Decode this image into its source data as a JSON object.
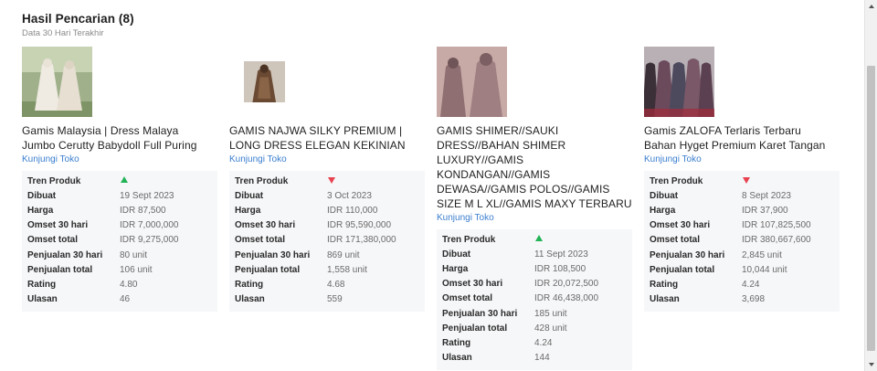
{
  "header": {
    "title": "Hasil Pencarian (8)",
    "subtitle": "Data 30 Hari Terakhir"
  },
  "labels": {
    "trend": "Tren Produk",
    "created": "Dibuat",
    "price": "Harga",
    "revenue_30": "Omset 30 hari",
    "revenue_total": "Omset total",
    "sales_30": "Penjualan 30 hari",
    "sales_total": "Penjualan total",
    "rating": "Rating",
    "reviews": "Ulasan"
  },
  "colors": {
    "trend_up": "#22b357",
    "trend_down": "#e8414f",
    "link": "#3a7ecf"
  },
  "products": [
    {
      "name_lines": [
        "Gamis Malaysia | Dress Malaya",
        "Jumbo Cerutty Babydoll Full Puring"
      ],
      "store_link": "Kunjungi Toko",
      "trend": "up",
      "trend_icon": "triangle-up-icon",
      "created": "19 Sept 2023",
      "price": "IDR 87,500",
      "revenue_30": "IDR 7,000,000",
      "revenue_total": "IDR 9,275,000",
      "sales_30": "80 unit",
      "sales_total": "106 unit",
      "rating": "4.80",
      "reviews": "46"
    },
    {
      "name_lines": [
        "GAMIS NAJWA SILKY PREMIUM |",
        "LONG DRESS ELEGAN KEKINIAN"
      ],
      "store_link": "Kunjungi Toko",
      "trend": "down",
      "trend_icon": "triangle-down-icon",
      "created": "3 Oct 2023",
      "price": "IDR 110,000",
      "revenue_30": "IDR 95,590,000",
      "revenue_total": "IDR 171,380,000",
      "sales_30": "869 unit",
      "sales_total": "1,558 unit",
      "rating": "4.68",
      "reviews": "559"
    },
    {
      "name_lines": [
        "GAMIS SHIMER//SAUKI",
        "DRESS//BAHAN SHIMER",
        "LUXURY//GAMIS",
        "KONDANGAN//GAMIS",
        "DEWASA//GAMIS POLOS//GAMIS",
        "SIZE M L XL//GAMIS MAXY TERBARU"
      ],
      "store_link": "Kunjungi Toko",
      "trend": "up",
      "trend_icon": "triangle-up-icon",
      "created": "11 Sept 2023",
      "price": "IDR 108,500",
      "revenue_30": "IDR 20,072,500",
      "revenue_total": "IDR 46,438,000",
      "sales_30": "185 unit",
      "sales_total": "428 unit",
      "rating": "4.24",
      "reviews": "144"
    },
    {
      "name_lines": [
        "Gamis ZALOFA Terlaris Terbaru",
        "Bahan Hyget Premium Karet Tangan"
      ],
      "store_link": "Kunjungi Toko",
      "trend": "down",
      "trend_icon": "triangle-down-icon",
      "created": "8 Sept 2023",
      "price": "IDR 37,900",
      "revenue_30": "IDR 107,825,500",
      "revenue_total": "IDR 380,667,600",
      "sales_30": "2,845 unit",
      "sales_total": "10,044 unit",
      "rating": "4.24",
      "reviews": "3,698"
    }
  ]
}
